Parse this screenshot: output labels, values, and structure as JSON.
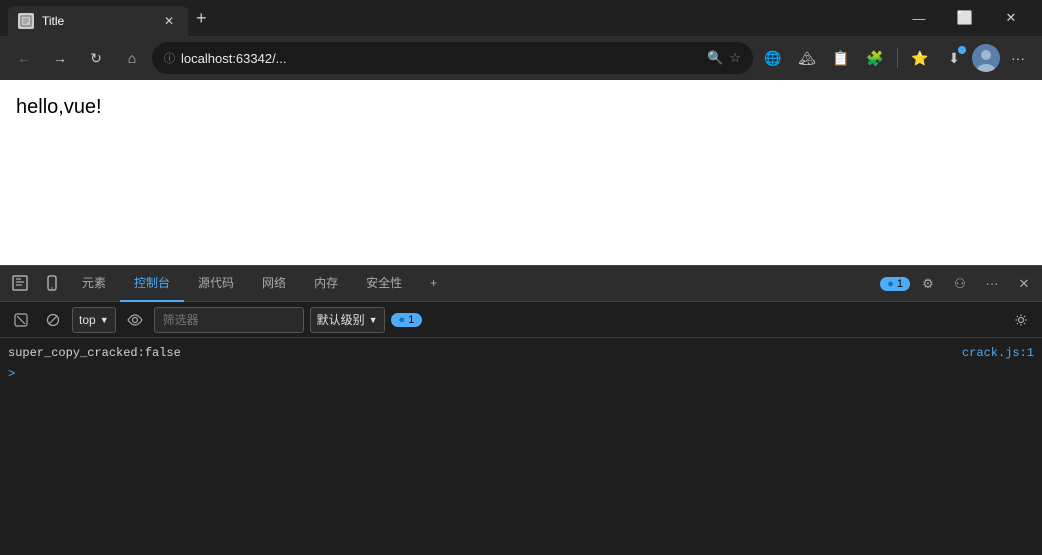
{
  "titlebar": {
    "tab": {
      "favicon": "📄",
      "title": "Title",
      "close": "✕"
    },
    "new_tab": "+",
    "window_controls": {
      "minimize": "—",
      "maximize": "⬜",
      "close": "✕"
    }
  },
  "toolbar": {
    "back": "←",
    "forward": "→",
    "reload": "↻",
    "home": "⌂",
    "address_info": "ⓘ",
    "address_url": "localhost:63342/...",
    "zoom": "🔍",
    "star": "☆",
    "extension1": "🌐",
    "extension2": "🏔",
    "clipboard": "📋",
    "puzzle": "🧩",
    "favorites": "⭐",
    "downloads": "⬇",
    "more": "···"
  },
  "page": {
    "content": "hello,vue!"
  },
  "devtools": {
    "tabs": [
      {
        "id": "inspect",
        "label": "检查元素",
        "icon": "⬚"
      },
      {
        "id": "device",
        "label": "设备",
        "icon": "📱"
      },
      {
        "id": "elements",
        "label": "元素"
      },
      {
        "id": "console",
        "label": "控制台",
        "active": true
      },
      {
        "id": "sources",
        "label": "源代码"
      },
      {
        "id": "network",
        "label": "网络"
      },
      {
        "id": "memory",
        "label": "内存"
      },
      {
        "id": "security",
        "label": "安全性"
      },
      {
        "id": "add",
        "label": "+"
      }
    ],
    "badge_count": "1",
    "badge_icon": "●",
    "actions": {
      "settings": "⚙",
      "more_tools": "⚇",
      "more_menu": "···",
      "close": "✕"
    }
  },
  "console_toolbar": {
    "clear": "🚫",
    "circle_cross": "⊘",
    "context": "top",
    "context_arrow": "▼",
    "eye": "👁",
    "filter_placeholder": "筛选器",
    "level": "默认级别",
    "level_arrow": "▼",
    "badge_icon": "●",
    "badge_count": "1",
    "settings": "⚙"
  },
  "console": {
    "log_text": "super_copy_cracked:false",
    "log_source": "crack.js:1",
    "prompt_chevron": ">"
  }
}
